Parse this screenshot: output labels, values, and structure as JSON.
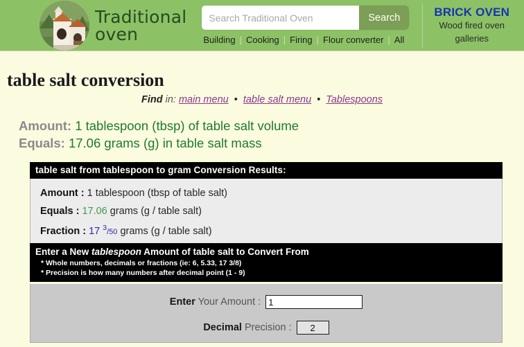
{
  "header": {
    "logo": {
      "line1": "Traditional",
      "line2": "oven",
      "icon": "brick-oven-photo"
    },
    "search": {
      "placeholder": "Search Traditional Oven",
      "value": "",
      "button_label": "Search"
    },
    "nav": [
      {
        "label": "Building"
      },
      {
        "label": "Cooking"
      },
      {
        "label": "Firing"
      },
      {
        "label": "Flour converter"
      },
      {
        "label": "All"
      }
    ],
    "nav_separator": "|",
    "promo": {
      "title": "BRICK OVEN",
      "line1": "Wood fired oven",
      "line2": "galleries"
    },
    "bg_color": "#8cc265"
  },
  "page_title": "table salt conversion",
  "find_line": {
    "find_label": "Find",
    "in_label": "in:",
    "bullet": "•",
    "links": [
      {
        "label": "main menu"
      },
      {
        "label": "table salt menu"
      },
      {
        "label": "Tablespoons"
      }
    ],
    "link_color": "#8b3a8b"
  },
  "summary": {
    "amount_label": "Amount:",
    "amount_value": "1 tablespoon (tbsp) of table salt volume",
    "equals_label": "Equals:",
    "equals_value": "17.06 grams (g) in table salt mass",
    "value_color": "#1f7a2e"
  },
  "results": {
    "header": "table salt from tablespoon to gram Conversion Results:",
    "rows": [
      {
        "label": "Amount :",
        "value": "1",
        "unit": "tablespoon (tbsp of table salt)"
      },
      {
        "label": "Equals :",
        "value": "17.06",
        "unit": "grams (g / table salt)"
      },
      {
        "label": "Fraction :",
        "whole": "17",
        "numerator": "3",
        "slash": "/",
        "denominator": "50",
        "unit": "grams (g / table salt)"
      }
    ]
  },
  "enter_section": {
    "title_pre": "Enter a New ",
    "title_em": "tablespoon",
    "title_post": " Amount of table salt to Convert From",
    "note1": "* Whole numbers, decimals or fractions (ie: 6, 5.33, 17 3/8)",
    "note2": "* Precision is how many numbers after decimal point (1 - 9)"
  },
  "form": {
    "amount_label_bold": "Enter",
    "amount_label_rest": " Your Amount :",
    "amount_value": "1",
    "precision_label_bold": "Decimal",
    "precision_label_rest": " Precision :",
    "precision_value": "2"
  }
}
